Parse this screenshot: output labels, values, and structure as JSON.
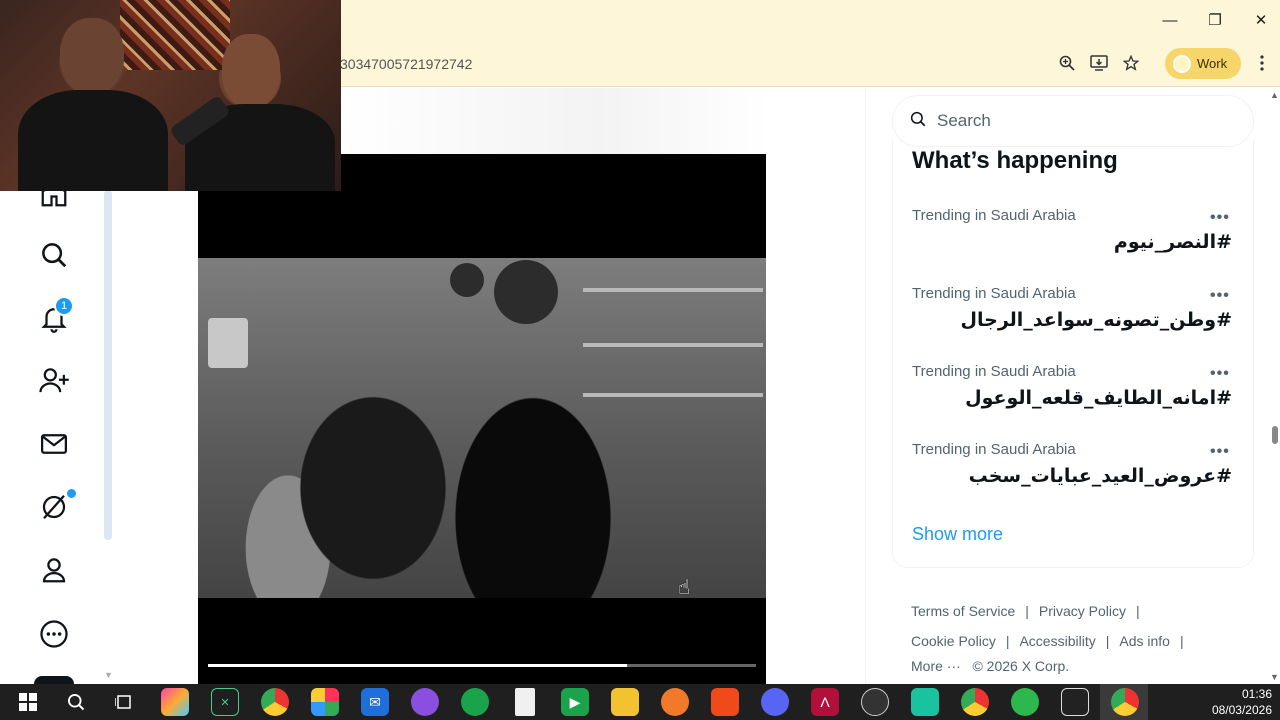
{
  "window": {
    "minimize": "—",
    "restore": "❐",
    "close": "✕"
  },
  "address_bar": {
    "url_fragment": "30347005721972742",
    "profile_label": "Work",
    "zoom_icon": "zoom-icon",
    "install_icon": "install-icon",
    "star_icon": "star-icon",
    "menu_icon": "kebab-menu-icon"
  },
  "nav": {
    "notifications_badge": "1",
    "items": [
      "home",
      "explore",
      "notifications",
      "follow",
      "messages",
      "grok",
      "profile",
      "more"
    ]
  },
  "video": {
    "progress": 0.765
  },
  "search": {
    "placeholder": "Search"
  },
  "whats_happening": {
    "title": "What’s happening",
    "trends": [
      {
        "meta": "Trending in Saudi Arabia",
        "tag": "#النصر_نيوم",
        "more": "•••"
      },
      {
        "meta": "Trending in Saudi Arabia",
        "tag": "#وطن_تصونه_سواعد_الرجال",
        "more": "•••"
      },
      {
        "meta": "Trending in Saudi Arabia",
        "tag": "#امانه_الطايف_قلعه_الوعول",
        "more": "•••"
      },
      {
        "meta": "Trending in Saudi Arabia",
        "tag": "#عروض_العيد_عبايات_سخب",
        "more": "•••"
      }
    ],
    "show_more": "Show more"
  },
  "footer": {
    "terms": "Terms of Service",
    "privacy": "Privacy Policy",
    "cookie": "Cookie Policy",
    "accessibility": "Accessibility",
    "ads": "Ads info",
    "more": "More ···",
    "copyright": "© 2026 X Corp.",
    "separator": "|"
  },
  "taskbar": {
    "time": "01:36",
    "date": "08/03/2026"
  }
}
